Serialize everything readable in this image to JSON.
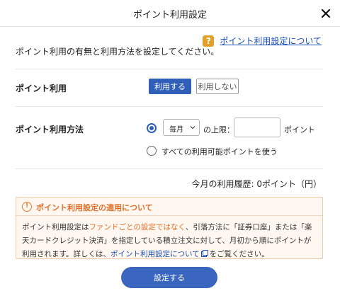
{
  "header": {
    "title": "ポイント利用設定",
    "close_icon": "close-icon"
  },
  "help": {
    "icon_text": "?",
    "link": "ポイント利用設定について"
  },
  "description": "ポイント利用の有無と利用方法を設定してください。",
  "usage": {
    "label": "ポイント利用",
    "use_label": "利用する",
    "no_use_label": "利用しない",
    "selected": "利用する"
  },
  "method": {
    "label": "ポイント利用方法",
    "option1": {
      "select_value": "毎月",
      "upper_limit_text": "の上限：",
      "limit_value": "",
      "unit": "ポイント",
      "checked": true
    },
    "option2": {
      "label": "すべての利用可能ポイントを使う",
      "checked": false
    }
  },
  "history": "今月の利用履歴: 0ポイント（円）",
  "notice": {
    "icon_text": "!",
    "title": "ポイント利用設定の適用について",
    "body_part1": "ポイント利用設定は",
    "body_highlight": "ファンドごとの設定ではなく",
    "body_part2": "、引落方法に「証券口座」または「楽天カードクレジット決済」を指定している積立注文に対して、月初から順にポイントが利用されます。詳しくは、",
    "body_link": "ポイント利用設定について",
    "body_part3": "をご覧ください。"
  },
  "submit_label": "設定する",
  "colors": {
    "primary": "#2f5fb8",
    "link": "#1a4fb5",
    "warning": "#e0702a",
    "help_badge": "#e0a02a"
  }
}
